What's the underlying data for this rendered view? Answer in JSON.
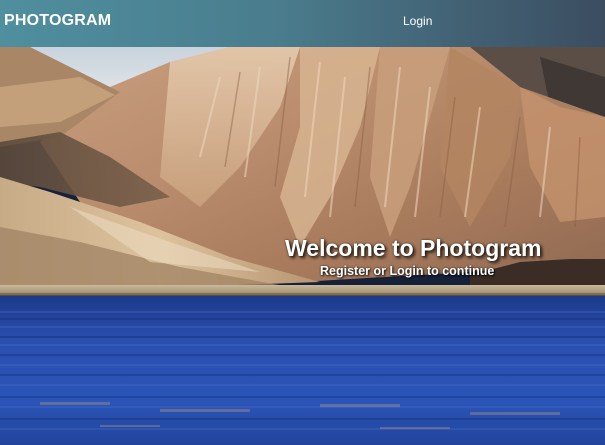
{
  "navbar": {
    "brand": "PHOTOGRAM",
    "login_label": "Login",
    "gradient_colors": [
      "#4f8f9e",
      "#4a7d8e",
      "#3c4d60"
    ]
  },
  "hero": {
    "title": "Welcome to Photogram",
    "subtitle": "Register or Login to continue",
    "background_image": "mountain-lake-landscape"
  }
}
